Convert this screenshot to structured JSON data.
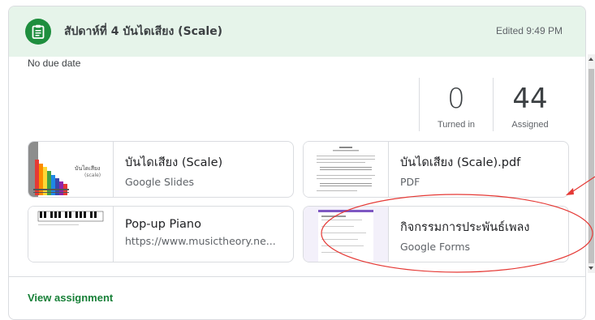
{
  "header": {
    "title": "สัปดาห์ที่ 4 บันไดเสียง (Scale)",
    "edited": "Edited 9:49 PM"
  },
  "due": "No due date",
  "stats": {
    "turned_in_count": "0",
    "turned_in_label": "Turned in",
    "assigned_count": "44",
    "assigned_label": "Assigned"
  },
  "attachments": [
    {
      "title": "บันไดเสียง (Scale)",
      "subtitle": "Google Slides",
      "thumb_text": "บันไดเสียง",
      "thumb_sub": "(scale)"
    },
    {
      "title": "บันไดเสียง (Scale).pdf",
      "subtitle": "PDF"
    },
    {
      "title": "Pop-up Piano",
      "subtitle": "https://www.musictheory.ne..."
    },
    {
      "title": "กิจกรรมการประพันธ์เพลง",
      "subtitle": "Google Forms"
    }
  ],
  "footer": {
    "view_label": "View assignment"
  },
  "colors": {
    "header_bg": "#e6f4ea",
    "accent": "#1e8e3e",
    "link": "#188038",
    "annotation": "#e53935"
  }
}
